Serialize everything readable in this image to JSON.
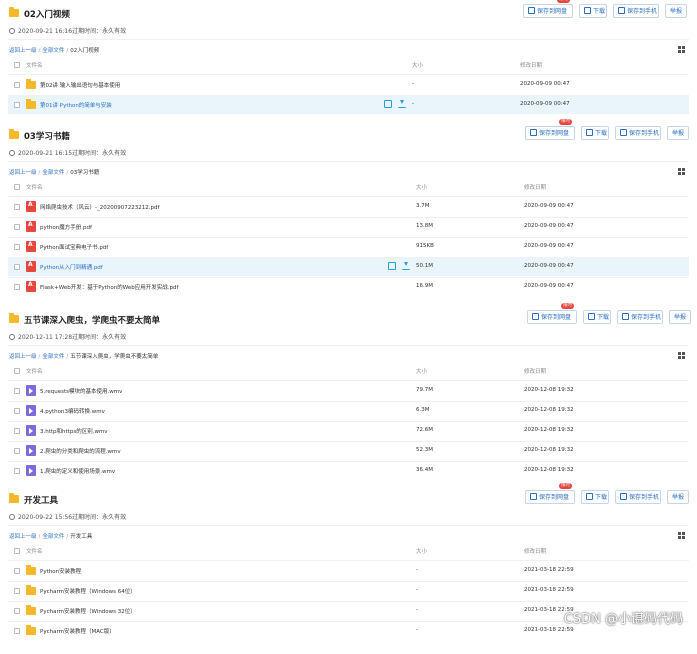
{
  "buttons": {
    "save": "保存到网盘",
    "download": "下载",
    "save_phone": "保存到手机",
    "more": "举报",
    "badge": "限时"
  },
  "crumb_common": {
    "back": "返回上一级",
    "all": "全部文件",
    "sep": "/"
  },
  "columns": {
    "name": "文件名",
    "size": "大小",
    "date": "修改日期"
  },
  "sections": [
    {
      "title": "02入门视频",
      "meta": "2020-09-21 16:16过期时间：永久有效",
      "crumb_current": "02入门视频",
      "rows": [
        {
          "name": "第02讲 输入输出语句与基本使用",
          "size": "-",
          "date": "2020-09-09 00:47",
          "icon": "folder",
          "selected": false
        },
        {
          "name": "第01讲 Python的简单与安装",
          "size": "-",
          "date": "2020-09-09 00:47",
          "icon": "folder",
          "selected": true
        }
      ]
    },
    {
      "title": "03学习书籍",
      "meta": "2020-09-21 16:15过期时间：永久有效",
      "crumb_current": "03学习书籍",
      "rows": [
        {
          "name": "网络爬虫技术（风云）-_20200907223212.pdf",
          "size": "3.7M",
          "date": "2020-09-09 00:47",
          "icon": "pdf",
          "selected": false
        },
        {
          "name": "python魔方手册.pdf",
          "size": "13.8M",
          "date": "2020-09-09 00:47",
          "icon": "pdf",
          "selected": false
        },
        {
          "name": "Python面试宝典电子书.pdf",
          "size": "915KB",
          "date": "2020-09-09 00:47",
          "icon": "pdf",
          "selected": false
        },
        {
          "name": "Python从入门到精通.pdf",
          "size": "50.1M",
          "date": "2020-09-09 00:47",
          "icon": "pdf",
          "selected": true
        },
        {
          "name": "Flask+Web开发：基于Python的Web应用开发实战.pdf",
          "size": "16.9M",
          "date": "2020-09-09 00:47",
          "icon": "pdf",
          "selected": false
        }
      ]
    },
    {
      "title": "五节课深入爬虫，学爬虫不要太简单",
      "meta": "2020-12-11 17:28过期时间：永久有效",
      "crumb_current": "五节课深入爬虫，学爬虫不要太简单",
      "rows": [
        {
          "name": "5.requests模块的基本使用.wmv",
          "size": "79.7M",
          "date": "2020-12-08 19:32",
          "icon": "video",
          "selected": false
        },
        {
          "name": "4.python3编码转换.wmv",
          "size": "6.3M",
          "date": "2020-12-08 19:32",
          "icon": "video",
          "selected": false
        },
        {
          "name": "3.http和https的区别.wmv",
          "size": "72.6M",
          "date": "2020-12-08 19:32",
          "icon": "video",
          "selected": false
        },
        {
          "name": "2.爬虫的分类和爬虫的流程.wmv",
          "size": "52.3M",
          "date": "2020-12-08 19:32",
          "icon": "video",
          "selected": false
        },
        {
          "name": "1.爬虫的定义和使用场景.wmv",
          "size": "36.4M",
          "date": "2020-12-08 19:32",
          "icon": "video",
          "selected": false
        }
      ]
    },
    {
      "title": "开发工具",
      "meta": "2020-09-22 15:56过期时间：永久有效",
      "crumb_current": "开发工具",
      "rows": [
        {
          "name": "Python安装教程",
          "size": "-",
          "date": "2021-03-18 22:59",
          "icon": "folder",
          "selected": false
        },
        {
          "name": "Pycharm安装教程（Windows 64位）",
          "size": "-",
          "date": "2021-03-18 22:59",
          "icon": "folder",
          "selected": false
        },
        {
          "name": "Pycharm安装教程（Windows 32位）",
          "size": "-",
          "date": "2021-03-18 22:59",
          "icon": "folder",
          "selected": false
        },
        {
          "name": "Pycharm安装教程（MAC版）",
          "size": "-",
          "date": "2021-03-18 22:59",
          "icon": "folder",
          "selected": false
        }
      ]
    }
  ],
  "watermark": "CSDN @小谌码代码"
}
